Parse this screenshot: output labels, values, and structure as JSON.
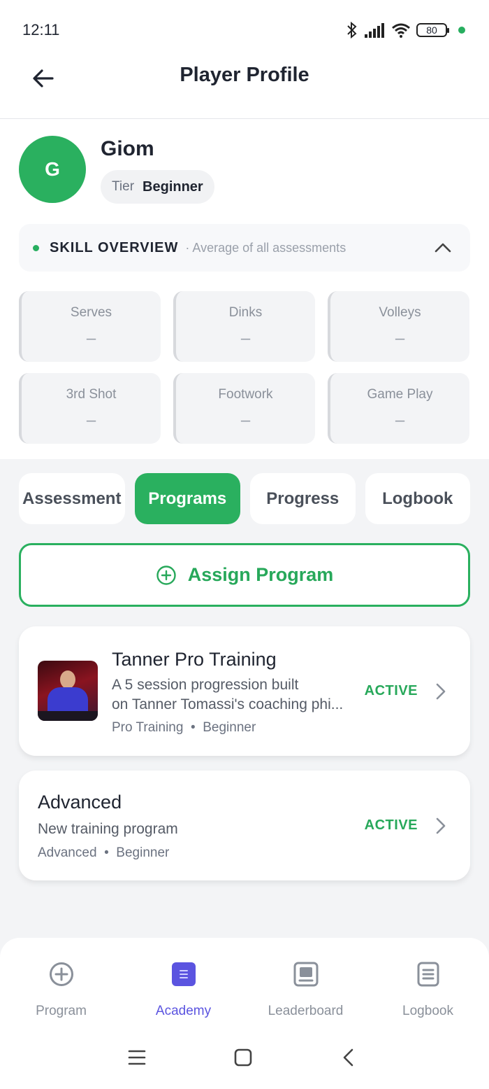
{
  "status_bar": {
    "time": "12:11",
    "battery": "80",
    "icons": [
      "bluetooth-icon",
      "signal-icon",
      "wifi-icon",
      "battery-icon"
    ]
  },
  "header": {
    "title": "Player Profile",
    "back_icon": "arrow-left-icon"
  },
  "player": {
    "initial": "G",
    "name": "Giom",
    "tier_label": "Tier",
    "tier_value": "Beginner",
    "avatar_color": "#2ab05f"
  },
  "skill_overview": {
    "title": "SKILL OVERVIEW",
    "subtitle": "· Average of all assessments",
    "skills": [
      {
        "name": "Serves",
        "value": "–"
      },
      {
        "name": "Dinks",
        "value": "–"
      },
      {
        "name": "Volleys",
        "value": "–"
      },
      {
        "name": "3rd Shot",
        "value": "–"
      },
      {
        "name": "Footwork",
        "value": "–"
      },
      {
        "name": "Game Play",
        "value": "–"
      }
    ]
  },
  "tabs": [
    {
      "label": "Assessment",
      "active": false
    },
    {
      "label": "Programs",
      "active": true
    },
    {
      "label": "Progress",
      "active": false
    },
    {
      "label": "Logbook",
      "active": false
    }
  ],
  "assign_button": {
    "label": "Assign Program",
    "icon": "plus-circle-icon"
  },
  "programs": [
    {
      "title": "Tanner Pro Training",
      "description_line1": "A 5 session progression built",
      "description_line2": "on Tanner Tomassi's coaching phi...",
      "category": "Pro Training",
      "separator": "•",
      "level": "Beginner",
      "status": "ACTIVE"
    },
    {
      "title": "Advanced",
      "description": "New training program",
      "category": "Advanced",
      "separator": "•",
      "level": "Beginner",
      "status": "ACTIVE"
    }
  ],
  "bottom_nav": [
    {
      "label": "Program",
      "icon": "plus-circle-icon",
      "active": false
    },
    {
      "label": "Academy",
      "icon": "academy-icon",
      "active": true
    },
    {
      "label": "Leaderboard",
      "icon": "leaderboard-icon",
      "active": false
    },
    {
      "label": "Logbook",
      "icon": "logbook-icon",
      "active": false
    }
  ],
  "colors": {
    "accent": "#2ab05f",
    "nav_active": "#5b54e0",
    "text": "#1f2430",
    "muted": "#8a909a"
  }
}
